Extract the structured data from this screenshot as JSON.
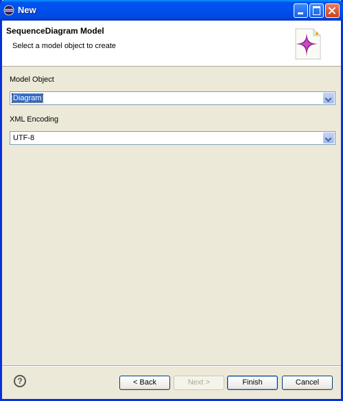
{
  "window": {
    "title": "New"
  },
  "header": {
    "title": "SequenceDiagram Model",
    "description": "Select a model object to create"
  },
  "fields": {
    "model_object": {
      "label": "Model Object",
      "value": "Diagram"
    },
    "xml_encoding": {
      "label": "XML Encoding",
      "value": "UTF-8"
    }
  },
  "buttons": {
    "back": "< Back",
    "next": "Next >",
    "finish": "Finish",
    "cancel": "Cancel"
  },
  "icons": {
    "title": "eclipse-icon",
    "wizard": "new-model-wizard-icon",
    "help": "help-icon"
  },
  "colors": {
    "titlebar": "#0053ee",
    "selection": "#316ac5",
    "dialog_bg": "#ece9d8"
  }
}
